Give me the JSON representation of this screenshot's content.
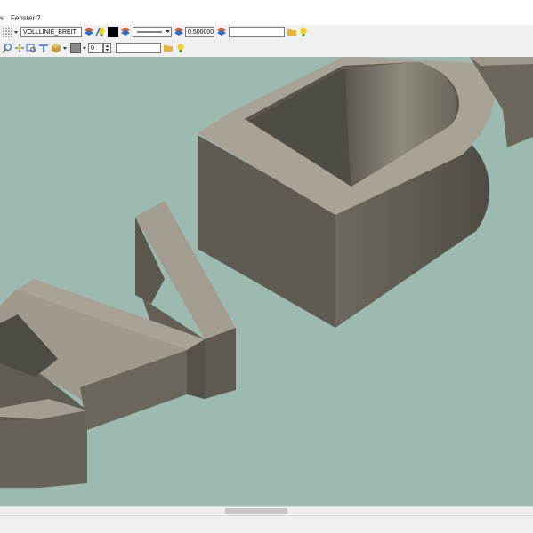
{
  "menubar": {
    "items": [
      {
        "label": "s"
      },
      {
        "label": "Fenster"
      },
      {
        "label": "?"
      }
    ]
  },
  "toolbar1": {
    "linetype_value": "VOLLLINIE_BREIT",
    "linewidth_value": "0.500000",
    "extra_field_value": "",
    "color_swatch": "#000000"
  },
  "toolbar2": {
    "number_value": "0",
    "text_field_value": ""
  },
  "viewport": {
    "background": "#9dbab0",
    "model_color": "#7a7568"
  }
}
